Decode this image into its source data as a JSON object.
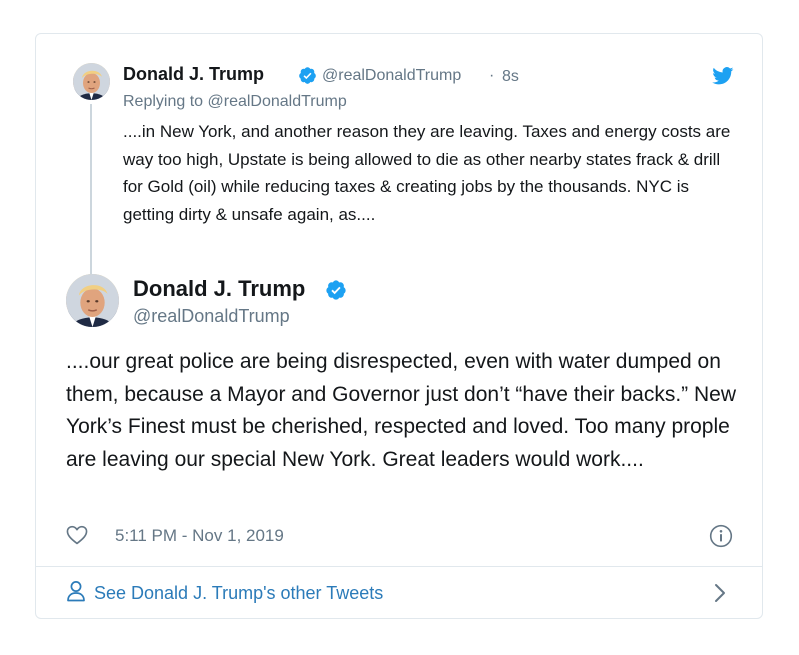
{
  "parent_tweet": {
    "name": "Donald J. Trump",
    "handle": "@realDonaldTrump",
    "separator": "·",
    "time": "8s",
    "replying_prefix": "Replying to",
    "replying_to": "@realDonaldTrump",
    "text": "....in New York, and another reason they are leaving. Taxes and energy costs are way too high, Upstate is being allowed to die as other nearby states frack & drill for Gold (oil) while reducing taxes & creating jobs by the thousands. NYC is getting dirty & unsafe again, as...."
  },
  "main_tweet": {
    "name": "Donald J. Trump",
    "handle": "@realDonaldTrump",
    "text": "....our great police are being disrespected, even with water dumped on them, because a Mayor and Governor just don’t “have their backs.” New York’s Finest must be cherished, respected and loved. Too many prople are leaving our special New York. Great leaders would work....",
    "timestamp": "5:11 PM - Nov 1, 2019"
  },
  "footer": {
    "link_label": "See Donald J. Trump's other Tweets"
  },
  "icons": {
    "verified": "verified-badge-icon",
    "bird": "twitter-bird-icon",
    "heart": "heart-icon",
    "info": "info-icon",
    "person": "person-icon",
    "chevron": "chevron-right-icon"
  },
  "colors": {
    "accent": "#1da1f2",
    "link": "#2b7bb9",
    "secondary_text": "#657786",
    "primary_text": "#14171a",
    "border": "#e1e8ed"
  }
}
